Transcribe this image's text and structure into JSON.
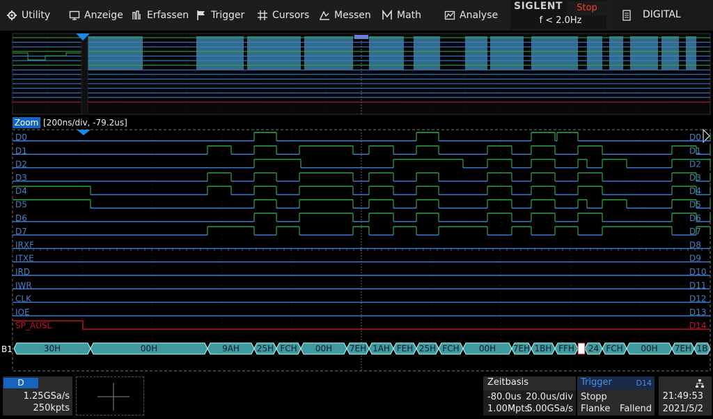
{
  "menu": [
    {
      "key": "utility",
      "label": "Utility"
    },
    {
      "key": "anzeige",
      "label": "Anzeige"
    },
    {
      "key": "erfassen",
      "label": "Erfassen"
    },
    {
      "key": "trigger",
      "label": "Trigger"
    },
    {
      "key": "cursors",
      "label": "Cursors"
    },
    {
      "key": "messen",
      "label": "Messen"
    },
    {
      "key": "math",
      "label": "Math"
    },
    {
      "key": "analyse",
      "label": "Analyse"
    }
  ],
  "brand": "SIGLENT",
  "run_state": "Stop",
  "trigger_freq": "f < 2.0Hz",
  "digital_label": "DIGITAL",
  "zoom": {
    "label": "Zoom",
    "info": "[200ns/div, -79.2us]"
  },
  "channels_left": [
    "D0",
    "D1",
    "D2",
    "D3",
    "D4",
    "D5",
    "D6",
    "D7",
    "IRXF",
    "ITXE",
    "IRD",
    "IWR",
    "CLK",
    "IOE",
    "SP_AUSL"
  ],
  "channels_right": [
    "D0",
    "D1",
    "D2",
    "D3",
    "D4",
    "D5",
    "D6",
    "D7",
    "D8",
    "D9",
    "D10",
    "D11",
    "D12",
    "D13",
    "D14"
  ],
  "bus": {
    "label": "B1",
    "values": [
      "30H",
      "00H",
      "9AH",
      "25H",
      "FCH",
      "00H",
      "7EH",
      "1AH",
      "FEH",
      "25H",
      "FCH",
      "00H",
      "7EH",
      "1BH",
      "FFH",
      "24",
      "FCH",
      "00H",
      "7EH",
      "1B"
    ]
  },
  "status": {
    "channel": "D",
    "sample_rate": "1.25GSa/s",
    "points": "250kpts",
    "timebase_title": "Zeitbasis",
    "delay": "-80.0us",
    "scale": "20.0us/div",
    "memory": "1.00Mpts",
    "rate": "5.00GSa/s",
    "trigger_title": "Trigger",
    "trigger_source": "D14",
    "trigger_mode": "Stopp",
    "trigger_type": "Flanke",
    "trigger_slope": "Fallend",
    "time": "21:49:53",
    "date": "2021/5/2"
  },
  "colors": {
    "high": "#2fa84a",
    "low": "#3f7fe0",
    "sp": "#c8102e",
    "bus_fill": "#3e9aa0",
    "grid": "#555555",
    "zoom_bg": "#1565c0"
  }
}
